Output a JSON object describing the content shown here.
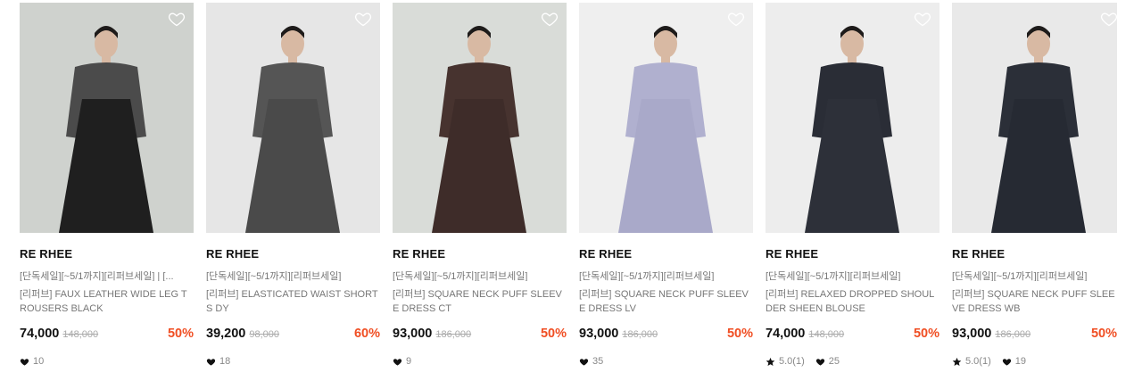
{
  "products": [
    {
      "brand": "RE RHEE",
      "promo": "[단독세일][~5/1까지][리퍼브세일] | [...",
      "name": "[리퍼브] FAUX LEATHER WIDE LEG TROUSERS BLACK",
      "price": "74,000",
      "original_price": "148,000",
      "discount": "50%",
      "rating": null,
      "likes": "10",
      "image_colors": {
        "bg": "#cfd2ce",
        "garment": "#1f1f1f",
        "top": "#4b4b4b"
      }
    },
    {
      "brand": "RE RHEE",
      "promo": "[단독세일][~5/1까지][리퍼브세일]",
      "name": "[리퍼브] ELASTICATED WAIST SHORTS DY",
      "price": "39,200",
      "original_price": "98,000",
      "discount": "60%",
      "rating": null,
      "likes": "18",
      "image_colors": {
        "bg": "#e6e6e6",
        "garment": "#4a4a4a",
        "top": "#555555"
      }
    },
    {
      "brand": "RE RHEE",
      "promo": "[단독세일][~5/1까지][리퍼브세일]",
      "name": "[리퍼브] SQUARE NECK PUFF SLEEVE DRESS CT",
      "price": "93,000",
      "original_price": "186,000",
      "discount": "50%",
      "rating": null,
      "likes": "9",
      "image_colors": {
        "bg": "#d9dcd8",
        "garment": "#3e2c29",
        "top": "#47332f"
      }
    },
    {
      "brand": "RE RHEE",
      "promo": "[단독세일][~5/1까지][리퍼브세일]",
      "name": "[리퍼브] SQUARE NECK PUFF SLEEVE DRESS LV",
      "price": "93,000",
      "original_price": "186,000",
      "discount": "50%",
      "rating": null,
      "likes": "35",
      "image_colors": {
        "bg": "#efefef",
        "garment": "#a9a9c9",
        "top": "#b0b0cf"
      }
    },
    {
      "brand": "RE RHEE",
      "promo": "[단독세일][~5/1까지][리퍼브세일]",
      "name": "[리퍼브] RELAXED DROPPED SHOULDER SHEEN BLOUSE",
      "price": "74,000",
      "original_price": "148,000",
      "discount": "50%",
      "rating": "5.0(1)",
      "likes": "25",
      "image_colors": {
        "bg": "#ededed",
        "garment": "#2d3039",
        "top": "#2a2d36"
      }
    },
    {
      "brand": "RE RHEE",
      "promo": "[단독세일][~5/1까지][리퍼브세일]",
      "name": "[리퍼브] SQUARE NECK PUFF SLEEVE DRESS WB",
      "price": "93,000",
      "original_price": "186,000",
      "discount": "50%",
      "rating": "5.0(1)",
      "likes": "19",
      "image_colors": {
        "bg": "#e9e9e9",
        "garment": "#262a33",
        "top": "#2b2f38"
      }
    }
  ],
  "colors": {
    "accent_discount": "#f04e23",
    "text_muted": "#777777"
  },
  "icons": {
    "wishlist": "heart-outline-icon",
    "like": "heart-filled-icon",
    "rating": "star-filled-icon"
  }
}
